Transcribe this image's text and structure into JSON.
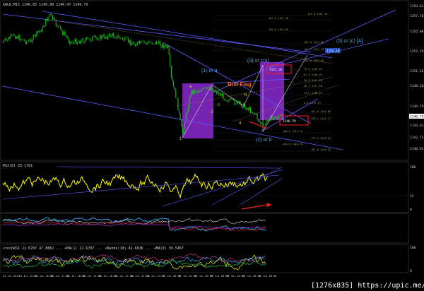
{
  "colors": {
    "background": "#000000",
    "candle": "#19d019",
    "rsi": "#ffff00",
    "trendline": "#5a5aff",
    "purple_zone": "#8a2ad0",
    "red_box": "#ff2020",
    "annotation_blue": "#4aa0ff",
    "annotation_orange": "#ff6020",
    "grid": "#333333"
  },
  "main_panel": {
    "header": "GOLD,M15  1146.83 1146.90 1146.47 1146.79",
    "price_axis": [
      "1359.61",
      "1357.78",
      "1354.08",
      "1352.78",
      "1351.36",
      "1148.20",
      "1146.79",
      "1144.61",
      "1142.71",
      "1140.91"
    ],
    "current_price_label": "1146.79",
    "fib_labels": [
      "161.8  1157.30",
      "261.8  1157.30",
      "200.0  1154.90",
      "161.8  1152.68",
      "127.2  1151.23",
      "100.0  1150.80",
      "78.6  1149.56",
      "61.8  1148.45",
      "50.0  1147.83",
      "38.2  1147.00",
      "23.6  1146.43",
      "0.0  1145.13",
      "100.0  1142.15",
      "161.8  1140.15",
      "161.8  1145.06",
      "138.2  1145.77",
      "127.2  1142.93",
      "161.8  1140.45"
    ],
    "annotations": {
      "wave_1_or_a": "(1) or a",
      "wave_3_or_c": "(3) or c(a)",
      "wave_2_or_b": "(2) or b",
      "wave_5_or_c": "(5) or (c) [A]",
      "bull_flag": "Bull Flag",
      "small_a": "a",
      "small_b": "b",
      "small_c": "c",
      "small_3": "3",
      "small_4": "4",
      "small_1": "1"
    },
    "red_box_top_label": "1151.26",
    "red_box_bottom_label": "1146.79",
    "tag_right_1": "1154.16"
  },
  "rsi_panel": {
    "header": "RSI(8) 25.1761",
    "axis": [
      "100",
      "52",
      "0"
    ]
  },
  "mid_panel": {
    "header": ""
  },
  "stoch_panel": {
    "header": "stochRSI 22.6707 47.8862 ... +MA(1) 22.6707 ... +Bands(10) 42.6036 ... +MA(9) 39.5467",
    "axis": [
      "100",
      "0"
    ]
  },
  "time_axis": [
    "24 Jul 2015",
    "24 Jul 15:00",
    "24 Jul 16:00",
    "24 Jul 17:00",
    "24 Jul 18:00",
    "24 Jul 19:00",
    "24 Jul 20:00",
    "24 Jul 21:00",
    "24 Jul 22:00",
    "24 Jul 23:00",
    "27 Jul 00:00",
    "27 Jul 01:00",
    "27 Jul 02:00",
    "27 Jul 03:00",
    "27 Jul 04:00",
    "27 Jul 05:00",
    "27 Jul 06:00"
  ],
  "watermark": "[1276x835] https://upic.me/"
}
